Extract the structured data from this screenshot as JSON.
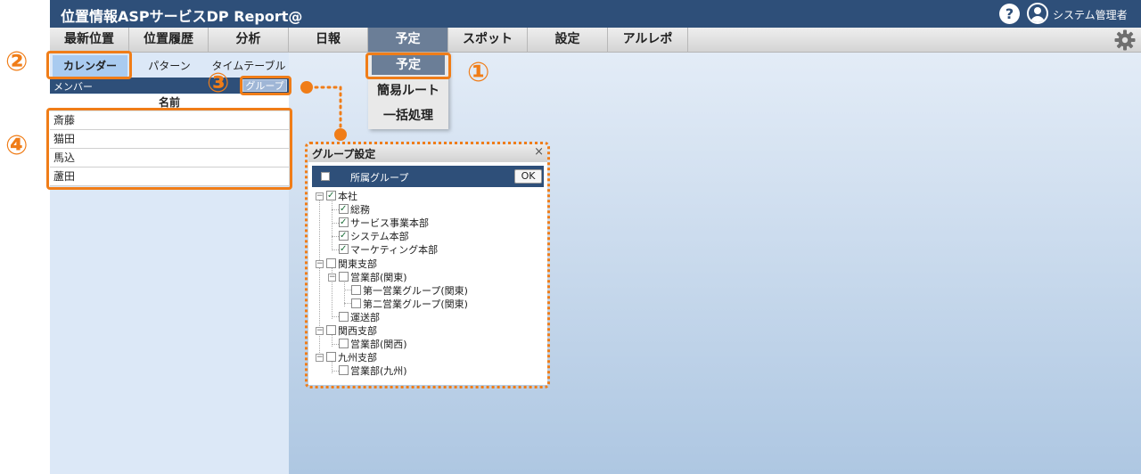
{
  "header": {
    "title": "位置情報ASPサービスDP Report@",
    "help_glyph": "?",
    "user_name": "システム管理者"
  },
  "menu": {
    "items": [
      {
        "label": "最新位置"
      },
      {
        "label": "位置履歴"
      },
      {
        "label": "分析"
      },
      {
        "label": "日報"
      },
      {
        "label": "予定"
      },
      {
        "label": "スポット"
      },
      {
        "label": "設定"
      },
      {
        "label": "アルレポ"
      }
    ],
    "active_index": 4
  },
  "dropdown": {
    "items": [
      "予定",
      "簡易ルート",
      "一括処理"
    ]
  },
  "subtabs": {
    "items": [
      "カレンダー",
      "パターン",
      "タイムテーブル"
    ],
    "active_index": 0
  },
  "member_panel": {
    "label": "メンバー",
    "group_button": "グループ",
    "column_header": "名前",
    "members": [
      "斎藤",
      "猫田",
      "馬込",
      "蘆田"
    ]
  },
  "group_settings": {
    "title": "グループ設定",
    "close_glyph": "×",
    "header_label": "所属グループ",
    "ok_label": "OK",
    "tree": [
      {
        "label": "本社",
        "checked": true
      },
      {
        "label": "総務",
        "checked": true
      },
      {
        "label": "サービス事業本部",
        "checked": true
      },
      {
        "label": "システム本部",
        "checked": true
      },
      {
        "label": "マーケティング本部",
        "checked": true
      },
      {
        "label": "関東支部",
        "checked": false
      },
      {
        "label": "営業部(関東)",
        "checked": false
      },
      {
        "label": "第一営業グループ(関東)",
        "checked": false
      },
      {
        "label": "第二営業グループ(関東)",
        "checked": false
      },
      {
        "label": "運送部",
        "checked": false
      },
      {
        "label": "関西支部",
        "checked": false
      },
      {
        "label": "営業部(関西)",
        "checked": false
      },
      {
        "label": "九州支部",
        "checked": false
      },
      {
        "label": "営業部(九州)",
        "checked": false
      }
    ]
  },
  "annotations": [
    "①",
    "②",
    "③",
    "④"
  ],
  "colors": {
    "header_bg": "#2e4f79",
    "accent_orange": "#f07d18",
    "active_menu": "#6b7e97",
    "subtab_active": "#a9cbf0",
    "panel_bg": "#dce8f7"
  }
}
